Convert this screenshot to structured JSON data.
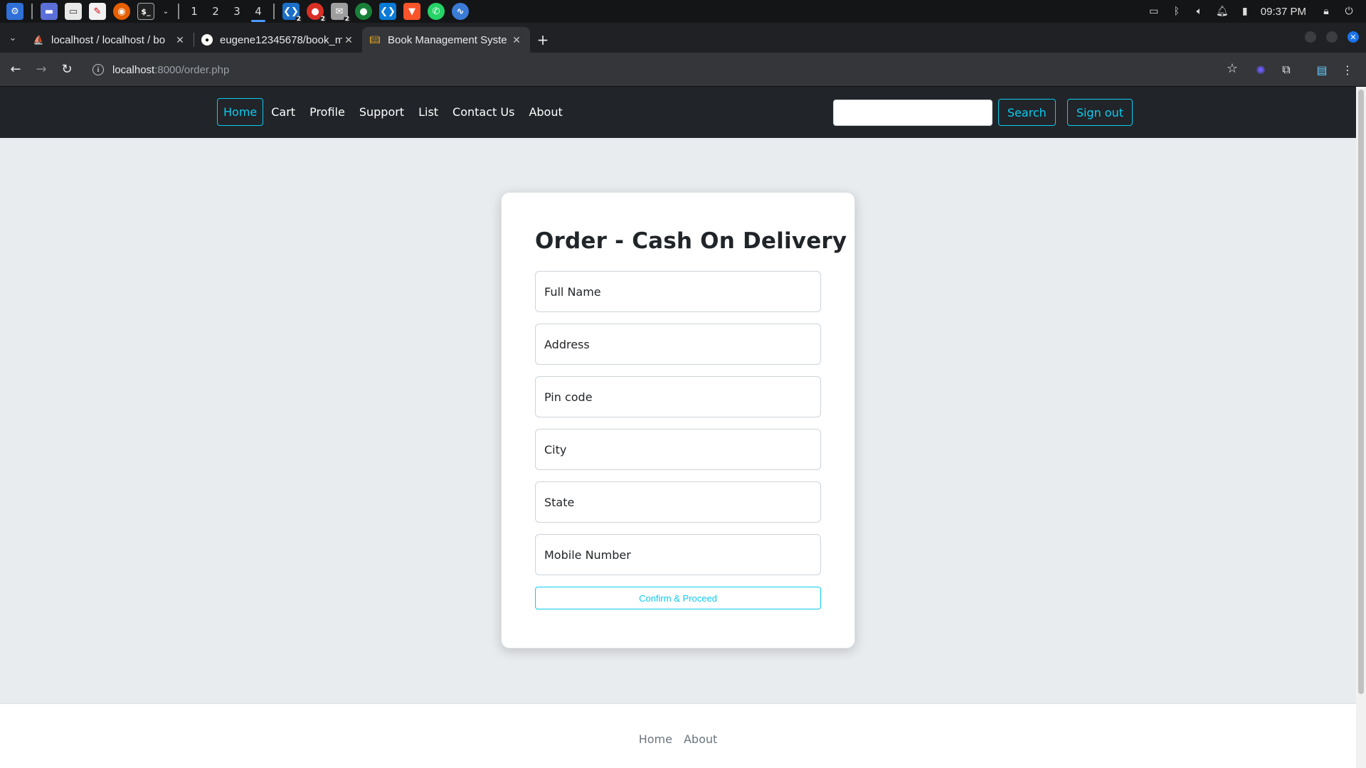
{
  "os": {
    "workspaces": [
      "1",
      "2",
      "3",
      "4"
    ],
    "active_workspace": "4",
    "badges": [
      "2",
      "2",
      "2"
    ],
    "clock": "09:37 PM"
  },
  "browser": {
    "tabs": [
      {
        "title": "localhost / localhost / bo",
        "favicon": "phpmyadmin-icon"
      },
      {
        "title": "eugene12345678/book_m",
        "favicon": "github-icon"
      },
      {
        "title": "Book Management Syste",
        "favicon": "book-icon",
        "active": true
      }
    ],
    "url": {
      "host": "localhost",
      "rest": ":8000/order.php"
    }
  },
  "site": {
    "nav_links": [
      "Home",
      "Cart",
      "Profile",
      "Support",
      "List",
      "Contact Us",
      "About"
    ],
    "active_link": "Home",
    "search_value": "",
    "search_button": "Search",
    "signout_button": "Sign out"
  },
  "order": {
    "title": "Order - Cash On Delivery",
    "fields": {
      "full_name": "Full Name",
      "address": "Address",
      "pin_code": "Pin code",
      "city": "City",
      "state": "State",
      "mobile": "Mobile Number"
    },
    "confirm_button": "Confirm & Proceed"
  },
  "footer": {
    "links": [
      "Home",
      "About"
    ]
  },
  "colors": {
    "accent": "#0dcaf0",
    "navbar": "#212529",
    "page_bg": "#e9ecef"
  }
}
